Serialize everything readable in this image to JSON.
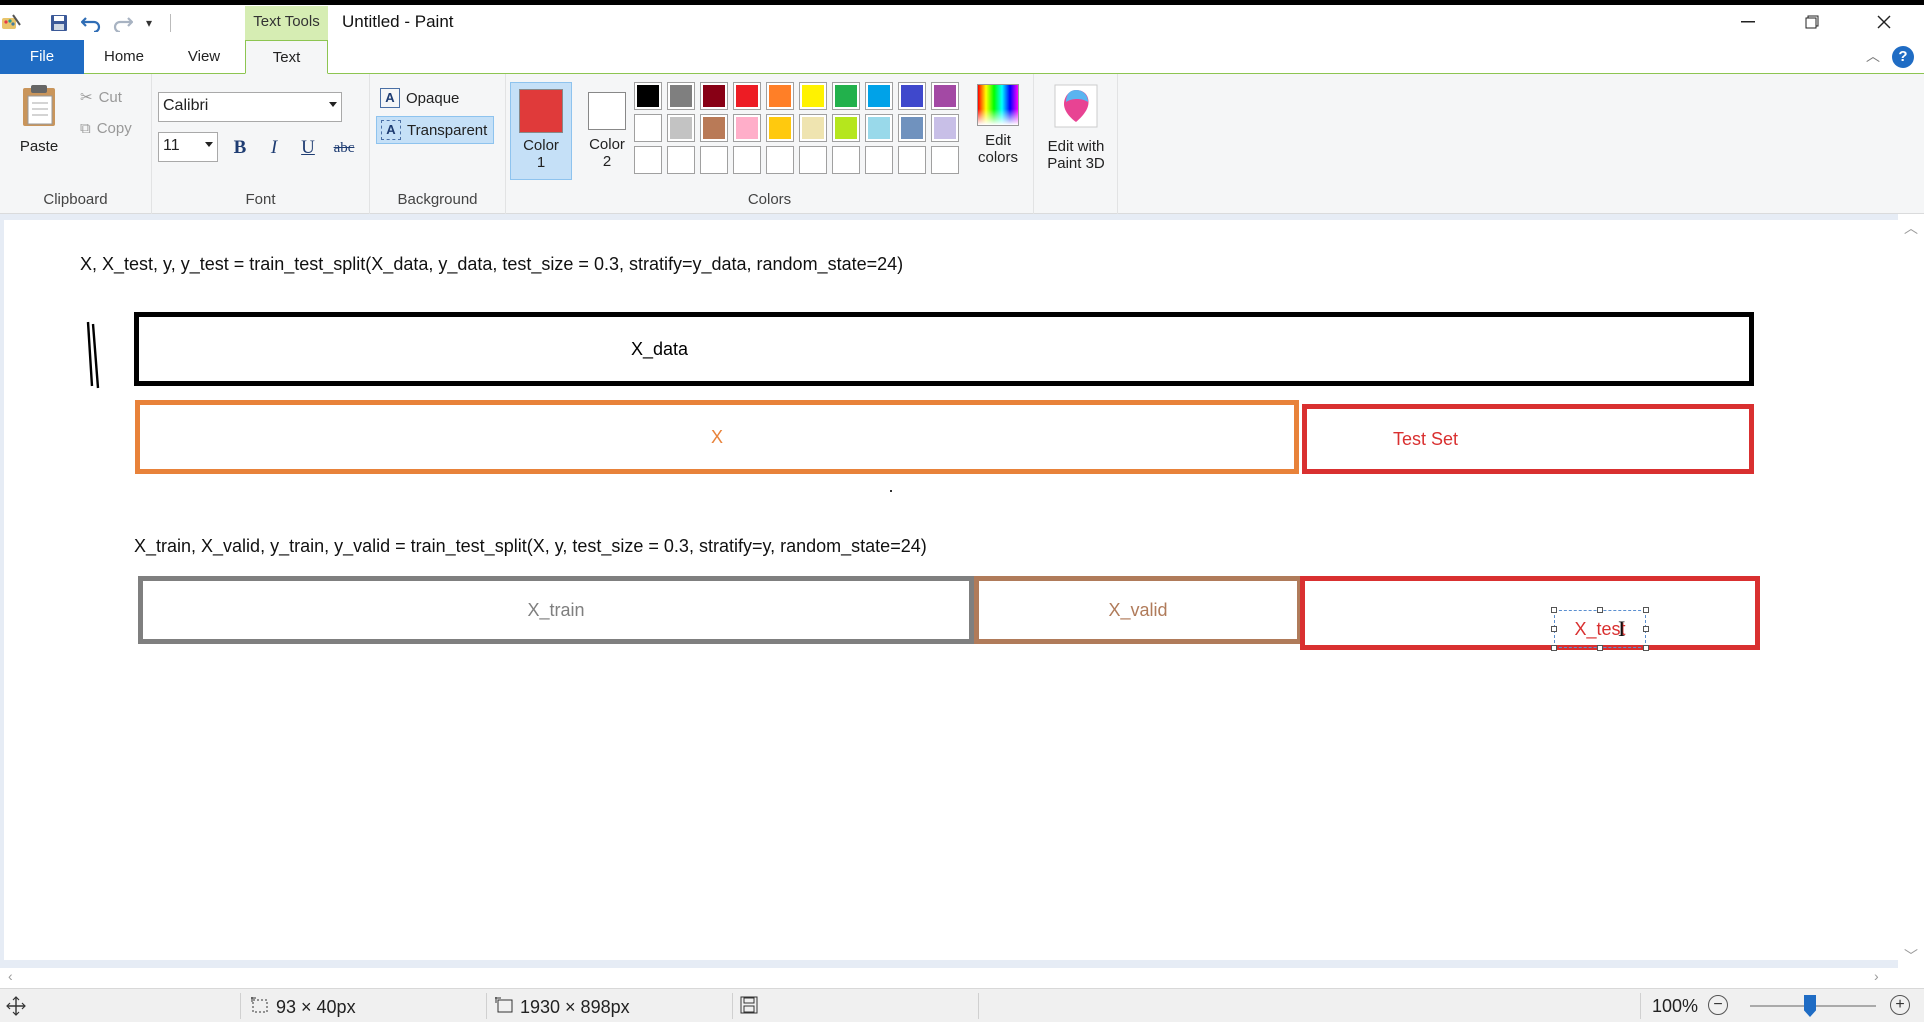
{
  "titlebar": {
    "contextual_tab": "Text Tools",
    "title": "Untitled - Paint"
  },
  "tabs": [
    {
      "label": "File"
    },
    {
      "label": "Home"
    },
    {
      "label": "View"
    },
    {
      "label": "Text"
    }
  ],
  "clipboard": {
    "paste": "Paste",
    "cut": "Cut",
    "copy": "Copy",
    "group": "Clipboard"
  },
  "font": {
    "family": "Calibri",
    "size": "11",
    "bold": "B",
    "italic": "I",
    "underline": "U",
    "strike": "abc",
    "group": "Font"
  },
  "background": {
    "opaque": "Opaque",
    "transparent": "Transparent",
    "group": "Background"
  },
  "colors": {
    "color1_label": "Color",
    "color1_num": "1",
    "color2_label": "Color",
    "color2_num": "2",
    "color1": "#e03a3a",
    "color2": "#ffffff",
    "edit_colors_l1": "Edit",
    "edit_colors_l2": "colors",
    "paint3d_l1": "Edit with",
    "paint3d_l2": "Paint 3D",
    "group": "Colors",
    "palette_row1": [
      "#000000",
      "#7f7f7f",
      "#880015",
      "#ed1c24",
      "#ff7f27",
      "#fff200",
      "#22b14c",
      "#00a2e8",
      "#3f48cc",
      "#a349a4"
    ],
    "palette_row2": [
      "#ffffff",
      "#c3c3c3",
      "#b97a57",
      "#ffaec9",
      "#ffc90e",
      "#efe4b0",
      "#b5e61d",
      "#99d9ea",
      "#7092be",
      "#c8bfe7"
    ]
  },
  "canvas": {
    "line1": "X, X_test, y, y_test = train_test_split(X_data, y_data, test_size = 0.3, stratify=y_data, random_state=24)",
    "box_xdata": "X_data",
    "box_x": "X",
    "box_testset": "Test Set",
    "line2": "X_train, X_valid, y_train, y_valid = train_test_split(X, y, test_size = 0.3, stratify=y, random_state=24)",
    "box_xtrain": "X_train",
    "box_xvalid": "X_valid",
    "text_editing": "X_test",
    "colors": {
      "black": "#000000",
      "orange": "#e8823a",
      "red": "#d93030",
      "gray": "#7f7f7f",
      "brown": "#b07b5a"
    }
  },
  "status": {
    "selection_size": "93 × 40px",
    "canvas_size": "1930 × 898px",
    "zoom": "100%"
  }
}
